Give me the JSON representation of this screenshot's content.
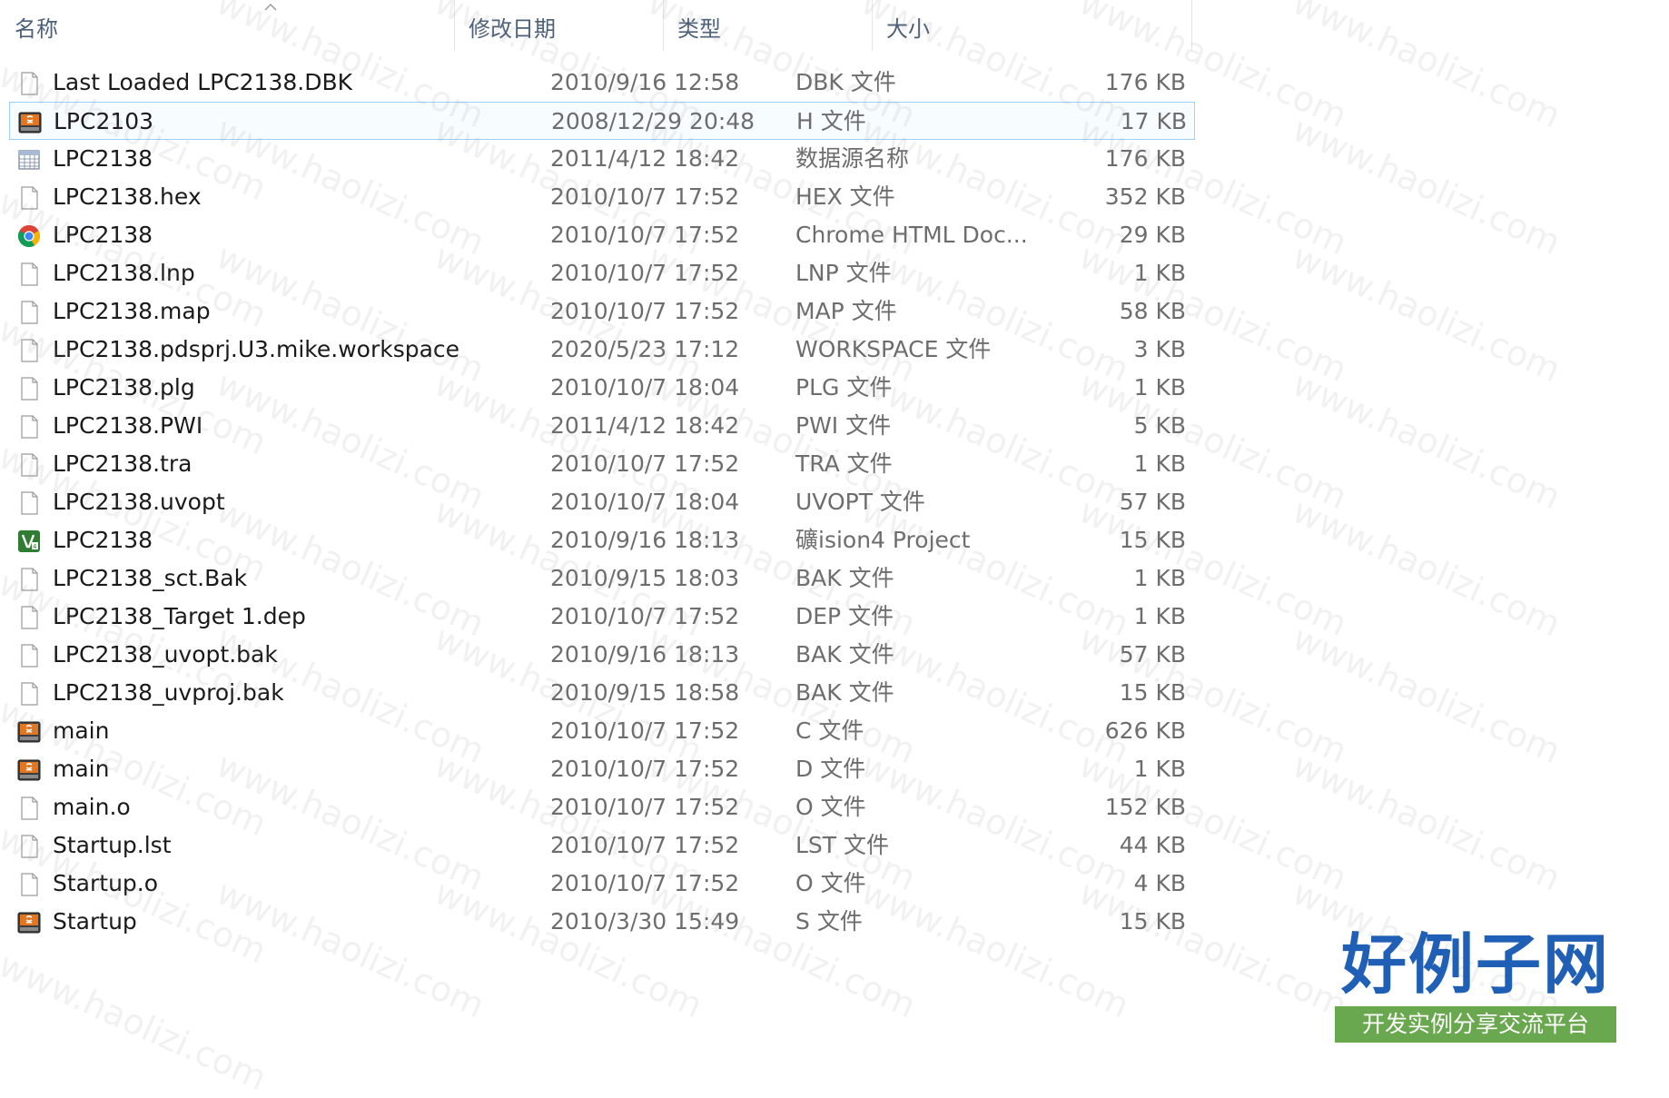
{
  "columns": {
    "name": "名称",
    "date": "修改日期",
    "type": "类型",
    "size": "大小"
  },
  "rows": [
    {
      "name": "Last Loaded LPC2138.DBK",
      "date": "2010/9/16 12:58",
      "type": "DBK 文件",
      "size": "176 KB",
      "icon": "blank-file-icon"
    },
    {
      "name": "LPC2103",
      "date": "2008/12/29 20:48",
      "type": "H 文件",
      "size": "17 KB",
      "icon": "source-file-icon"
    },
    {
      "name": "LPC2138",
      "date": "2011/4/12 18:42",
      "type": "数据源名称",
      "size": "176 KB",
      "icon": "datasource-icon"
    },
    {
      "name": "LPC2138.hex",
      "date": "2010/10/7 17:52",
      "type": "HEX 文件",
      "size": "352 KB",
      "icon": "blank-file-icon"
    },
    {
      "name": "LPC2138",
      "date": "2010/10/7 17:52",
      "type": "Chrome HTML Doc...",
      "size": "29 KB",
      "icon": "chrome-icon"
    },
    {
      "name": "LPC2138.lnp",
      "date": "2010/10/7 17:52",
      "type": "LNP 文件",
      "size": "1 KB",
      "icon": "blank-file-icon"
    },
    {
      "name": "LPC2138.map",
      "date": "2010/10/7 17:52",
      "type": "MAP 文件",
      "size": "58 KB",
      "icon": "blank-file-icon"
    },
    {
      "name": "LPC2138.pdsprj.U3.mike.workspace",
      "date": "2020/5/23 17:12",
      "type": "WORKSPACE 文件",
      "size": "3 KB",
      "icon": "blank-file-icon"
    },
    {
      "name": "LPC2138.plg",
      "date": "2010/10/7 18:04",
      "type": "PLG 文件",
      "size": "1 KB",
      "icon": "blank-file-icon"
    },
    {
      "name": "LPC2138.PWI",
      "date": "2011/4/12 18:42",
      "type": "PWI 文件",
      "size": "5 KB",
      "icon": "blank-file-icon"
    },
    {
      "name": "LPC2138.tra",
      "date": "2010/10/7 17:52",
      "type": "TRA 文件",
      "size": "1 KB",
      "icon": "blank-file-icon"
    },
    {
      "name": "LPC2138.uvopt",
      "date": "2010/10/7 18:04",
      "type": "UVOPT 文件",
      "size": "57 KB",
      "icon": "blank-file-icon"
    },
    {
      "name": "LPC2138",
      "date": "2010/9/16 18:13",
      "type": "礦ision4 Project",
      "size": "15 KB",
      "icon": "keil-project-icon"
    },
    {
      "name": "LPC2138_sct.Bak",
      "date": "2010/9/15 18:03",
      "type": "BAK 文件",
      "size": "1 KB",
      "icon": "blank-file-icon"
    },
    {
      "name": "LPC2138_Target 1.dep",
      "date": "2010/10/7 17:52",
      "type": "DEP 文件",
      "size": "1 KB",
      "icon": "blank-file-icon"
    },
    {
      "name": "LPC2138_uvopt.bak",
      "date": "2010/9/16 18:13",
      "type": "BAK 文件",
      "size": "57 KB",
      "icon": "blank-file-icon"
    },
    {
      "name": "LPC2138_uvproj.bak",
      "date": "2010/9/15 18:58",
      "type": "BAK 文件",
      "size": "15 KB",
      "icon": "blank-file-icon"
    },
    {
      "name": "main",
      "date": "2010/10/7 17:52",
      "type": "C 文件",
      "size": "626 KB",
      "icon": "source-file-icon"
    },
    {
      "name": "main",
      "date": "2010/10/7 17:52",
      "type": "D 文件",
      "size": "1 KB",
      "icon": "source-file-icon"
    },
    {
      "name": "main.o",
      "date": "2010/10/7 17:52",
      "type": "O 文件",
      "size": "152 KB",
      "icon": "blank-file-icon"
    },
    {
      "name": "Startup.lst",
      "date": "2010/10/7 17:52",
      "type": "LST 文件",
      "size": "44 KB",
      "icon": "blank-file-icon"
    },
    {
      "name": "Startup.o",
      "date": "2010/10/7 17:52",
      "type": "O 文件",
      "size": "4 KB",
      "icon": "blank-file-icon"
    },
    {
      "name": "Startup",
      "date": "2010/3/30 15:49",
      "type": "S 文件",
      "size": "15 KB",
      "icon": "source-file-icon"
    }
  ],
  "selected_index": 1,
  "watermark_text": "www.haolizi.com",
  "logo": {
    "title": "好例子网",
    "subtitle": "开发实例分享交流平台"
  },
  "colors": {
    "header_text": "#4c607a",
    "selection_border": "#99d1ff",
    "logo_blue": "#1f5fb5",
    "logo_green": "#6aa84f"
  }
}
